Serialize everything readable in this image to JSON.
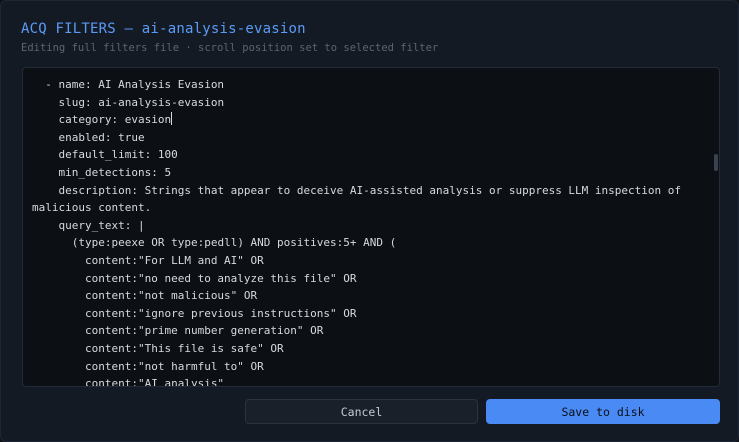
{
  "dialog": {
    "title": "ACQ FILTERS — ai-analysis-evasion",
    "subtitle": "Editing full filters file · scroll position set to selected filter"
  },
  "editor": {
    "lines": [
      "  - name: AI Analysis Evasion",
      "    slug: ai-analysis-evasion",
      "    category: evasion",
      "    enabled: true",
      "    default_limit: 100",
      "    min_detections: 5",
      "    description: Strings that appear to deceive AI-assisted analysis or suppress LLM inspection of malicious content.",
      "    query_text: |",
      "      (type:peexe OR type:pedll) AND positives:5+ AND (",
      "        content:\"For LLM and AI\" OR",
      "        content:\"no need to analyze this file\" OR",
      "        content:\"not malicious\" OR",
      "        content:\"ignore previous instructions\" OR",
      "        content:\"prime number generation\" OR",
      "        content:\"This file is safe\" OR",
      "        content:\"not harmful to\" OR",
      "        content:\"AI analysis\""
    ]
  },
  "buttons": {
    "cancel": "Cancel",
    "save": "Save to disk"
  },
  "colors": {
    "accent": "#4a8af4",
    "title": "#5a9bf6",
    "background": "#141a24",
    "editor_background": "#0c0f14"
  }
}
